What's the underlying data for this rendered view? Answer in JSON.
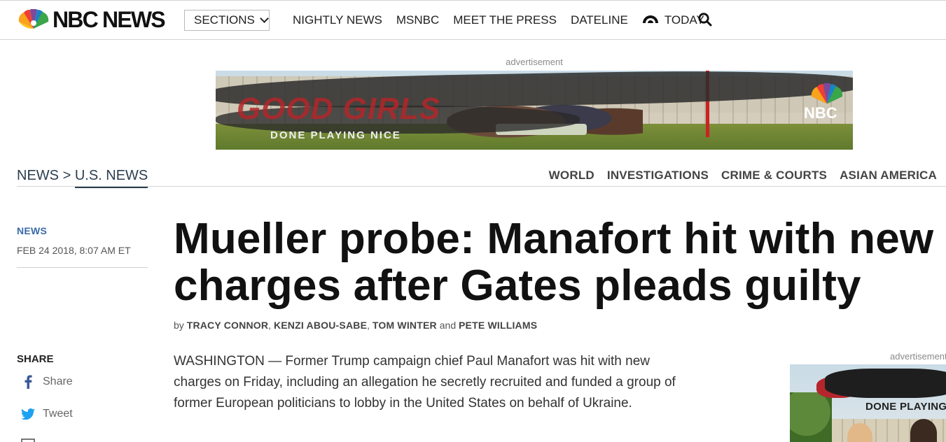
{
  "header": {
    "logo_text": "NBC NEWS",
    "sections_label": "SECTIONS",
    "nav": [
      "NIGHTLY NEWS",
      "MSNBC",
      "MEET THE PRESS",
      "DATELINE",
      "TODAY"
    ]
  },
  "top_ad": {
    "label": "advertisement",
    "brand": "GOOD GIRLS",
    "tagline": "DONE PLAYING NICE",
    "network": "NBC"
  },
  "section_bar": {
    "crumb_root": "NEWS",
    "crumb_sep": ">",
    "crumb_current": "U.S. NEWS",
    "subnav": [
      "WORLD",
      "INVESTIGATIONS",
      "CRIME & COURTS",
      "ASIAN AMERICA"
    ]
  },
  "article": {
    "category": "NEWS",
    "date": "FEB 24 2018, 8:07 AM ET",
    "headline_line1": "Mueller probe: Manafort hit with new",
    "headline_line2": "charges after Gates pleads guilty",
    "byline_prefix": "by",
    "authors": [
      "TRACY CONNOR",
      "KENZI ABOU-SABE",
      "TOM WINTER",
      "PETE WILLIAMS"
    ],
    "author_sep": ",",
    "author_and": "and",
    "body": "WASHINGTON — Former Trump campaign chief Paul Manafort was hit with new charges on Friday, including an allegation he secretly recruited and funded a group of former European politicians to lobby in the United States on behalf of Ukraine."
  },
  "share": {
    "title": "SHARE",
    "facebook_label": "Share",
    "twitter_label": "Tweet"
  },
  "side_ad": {
    "label": "advertisement",
    "tagline": "DONE PLAYING"
  },
  "colors": {
    "link_blue": "#3a6aa8",
    "section_navy": "#2c3e50",
    "facebook": "#3b5998",
    "twitter": "#1da1f2"
  }
}
